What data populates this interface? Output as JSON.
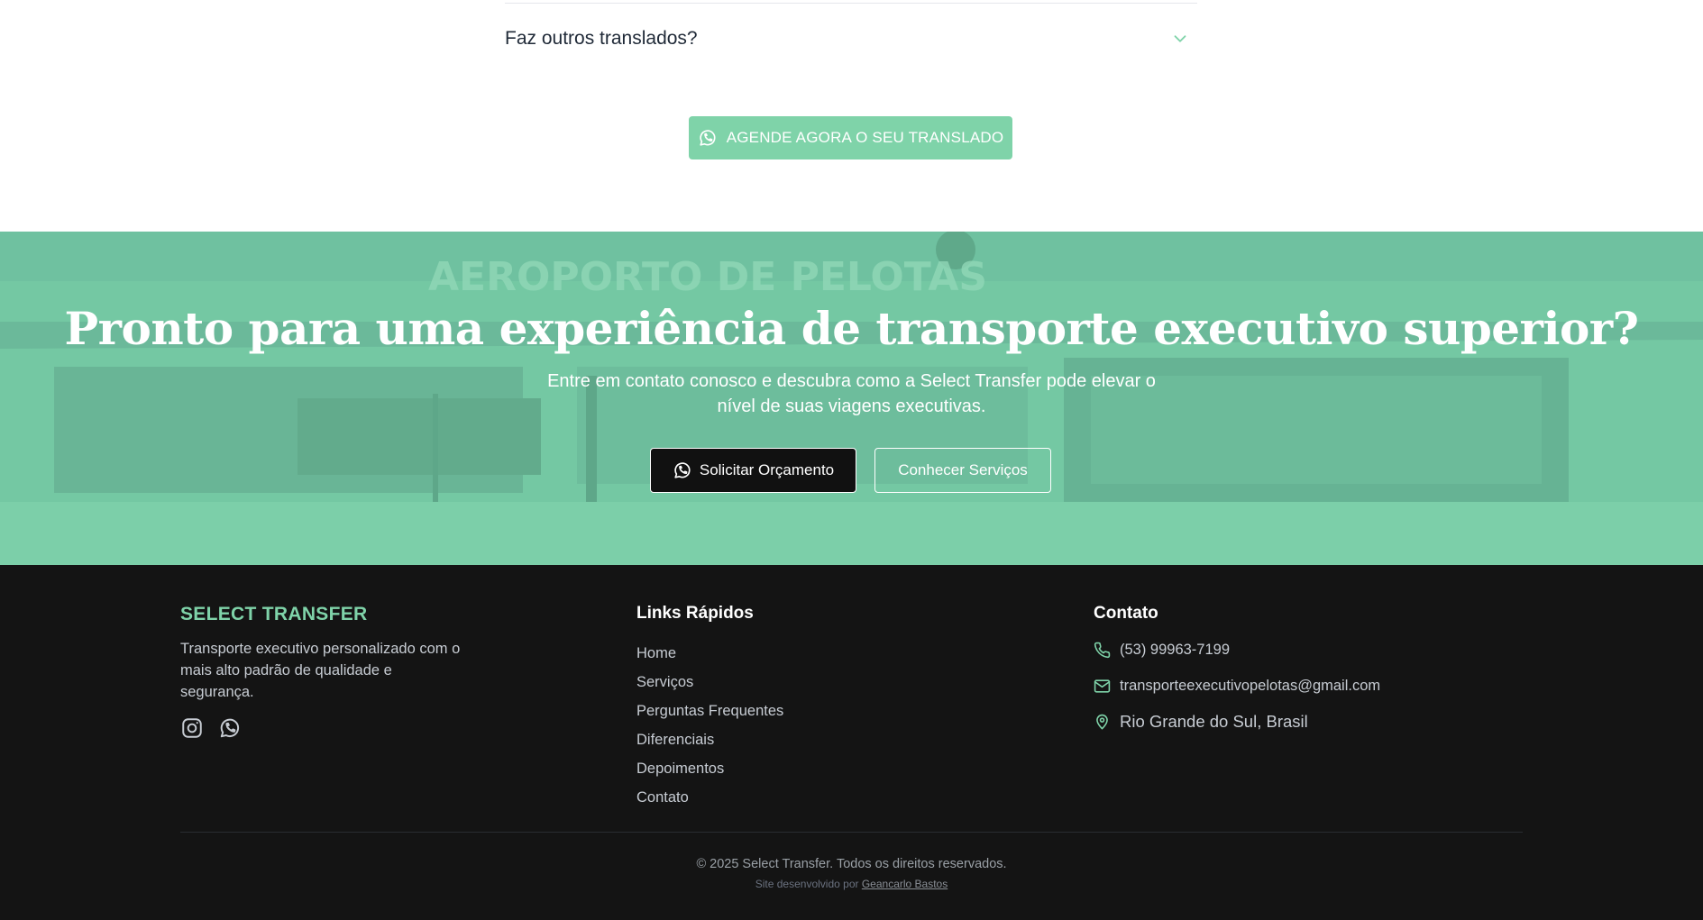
{
  "faq": {
    "question": "Faz outros translados?"
  },
  "cta": {
    "label": "AGENDE AGORA O SEU TRANSLADO"
  },
  "hero": {
    "background_sign": "AEROPORTO DE PELOTAS",
    "title": "Pronto para uma experiência de transporte executivo superior?",
    "subtitle": "Entre em contato conosco e descubra como a Select Transfer pode elevar o nível de suas viagens executivas.",
    "primary_button": "Solicitar Orçamento",
    "secondary_button": "Conhecer Serviços"
  },
  "footer": {
    "brand": "SELECT TRANSFER",
    "description": "Transporte executivo personalizado com o mais alto padrão de qualidade e segurança.",
    "links_title": "Links Rápidos",
    "links": [
      "Home",
      "Serviços",
      "Perguntas Frequentes",
      "Diferenciais",
      "Depoimentos",
      "Contato"
    ],
    "contact_title": "Contato",
    "phone": "(53) 99963-7199",
    "email": "transporteexecutivopelotas@gmail.com",
    "location": "Rio Grande do Sul, Brasil",
    "copyright": "© 2025 Select Transfer. Todos os direitos reservados.",
    "credit_prefix": "Site desenvolvido por",
    "credit_name": "Geancarlo Bastos"
  },
  "colors": {
    "accent": "#7fd3a9",
    "hero_overlay": "#74c8a3",
    "footer_bg": "#141414"
  },
  "icons": [
    "chevron-down-icon",
    "whatsapp-icon",
    "instagram-icon",
    "phone-icon",
    "mail-icon",
    "map-pin-icon"
  ]
}
